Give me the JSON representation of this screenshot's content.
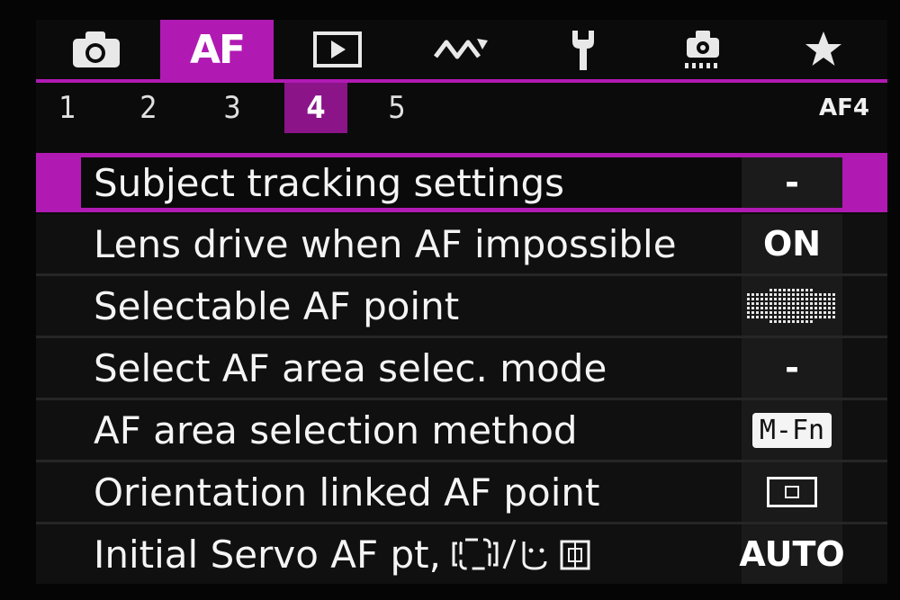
{
  "tabs": [
    {
      "id": "shooting",
      "icon": "camera-icon"
    },
    {
      "id": "af",
      "label": "AF",
      "active": true
    },
    {
      "id": "playback",
      "icon": "play-icon"
    },
    {
      "id": "wireless",
      "icon": "wireless-icon"
    },
    {
      "id": "setup",
      "icon": "wrench-icon"
    },
    {
      "id": "custom",
      "icon": "custom-functions-icon"
    },
    {
      "id": "mymenu",
      "icon": "star-icon"
    }
  ],
  "subtabs": [
    "1",
    "2",
    "3",
    "4",
    "5"
  ],
  "active_subtab": "4",
  "page_code": "AF4",
  "menu": [
    {
      "label": "Subject tracking settings",
      "value": "-"
    },
    {
      "label": "Lens drive when AF impossible",
      "value": "ON"
    },
    {
      "label": "Selectable AF point",
      "value_icon": "af-point-grid-icon"
    },
    {
      "label": "Select AF area selec. mode",
      "value": "-"
    },
    {
      "label": "AF area selection method",
      "value": "M-Fn"
    },
    {
      "label": "Orientation linked AF point",
      "value_icon": "frame-icon"
    },
    {
      "label": "Initial Servo AF pt, ",
      "value": "AUTO"
    }
  ],
  "colors": {
    "accent": "#b01ab3",
    "accent_dark": "#8a1488",
    "background": "#0b0b0b"
  }
}
